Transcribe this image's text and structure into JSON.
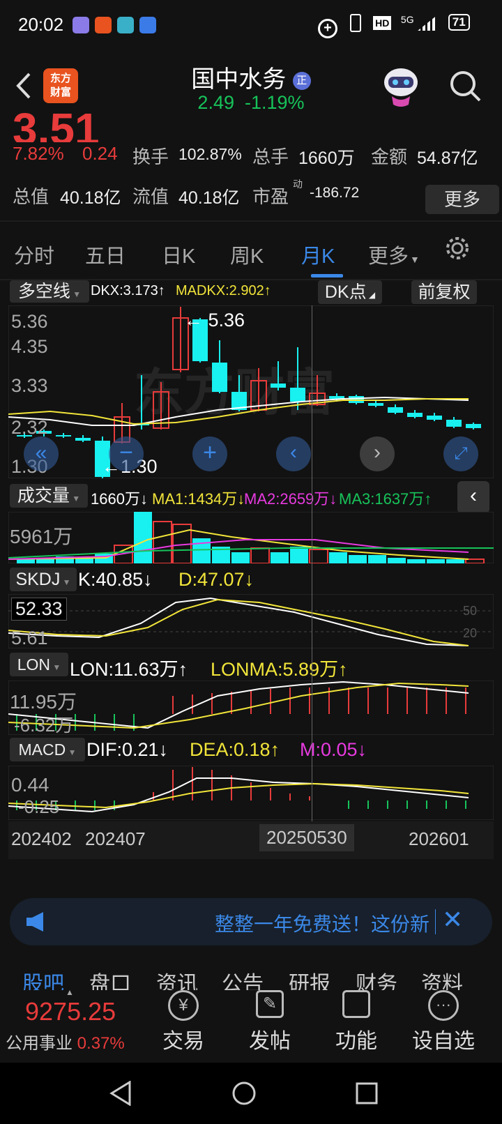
{
  "status": {
    "time": "20:02",
    "net": "5G",
    "battery": "71"
  },
  "header": {
    "logo_line1": "东方",
    "logo_line2": "财富",
    "title": "国中水务",
    "badge": "正",
    "price": "2.49",
    "change": "-1.19%"
  },
  "quote": {
    "price_big": "3.51",
    "pct": "7.82%",
    "chg": "0.24",
    "turnover_label": "换手",
    "turnover": "102.87%",
    "vol_label": "总手",
    "vol": "1660万",
    "amount_label": "金额",
    "amount": "54.87亿",
    "mcap_label": "总值",
    "mcap": "40.18亿",
    "float_label": "流值",
    "float": "40.18亿",
    "pe_label": "市盈",
    "pe_sup": "动",
    "pe": "-186.72",
    "more": "更多"
  },
  "tabs": [
    "分时",
    "五日",
    "日K",
    "周K",
    "月K",
    "更多"
  ],
  "main_chart": {
    "indicator": "多空线",
    "dkx": "DKX:3.173↑",
    "madkx": "MADKX:2.902↑",
    "dk_btn": "DK点",
    "fq_btn": "前复权",
    "ticks": [
      "5.36",
      "4.35",
      "3.33",
      "2.32",
      "1.30"
    ],
    "high_label": "← 5.36",
    "low_label": "←1.30"
  },
  "volume": {
    "label": "成交量",
    "vol": "1660万↓",
    "ma1": "MA1:1434万↓",
    "ma2": "MA2:2659万↓",
    "ma3": "MA3:1637万↑",
    "tick": "5961万"
  },
  "skdj": {
    "label": "SKDJ",
    "k": "K:40.85↓",
    "d": "D:47.07↓",
    "t1": "52.33",
    "t2": "5.61",
    "r1": "50",
    "r2": "20"
  },
  "lon": {
    "label": "LON",
    "lon": "LON:11.63万↑",
    "lonma": "LONMA:5.89万↑",
    "t1": "11.95万",
    "t2": "-6.32万"
  },
  "macd": {
    "label": "MACD",
    "dif": "DIF:0.21↓",
    "dea": "DEA:0.18↑",
    "m": "M:0.05↓",
    "t1": "0.44",
    "t2": "-0.25"
  },
  "dates": [
    "202402",
    "202407",
    "20250530",
    "202601"
  ],
  "ad": {
    "text": "整整一年免费送！这份新"
  },
  "bottom_tabs": [
    "股吧",
    "盘口",
    "资讯",
    "公告",
    "研报",
    "财务",
    "资料"
  ],
  "footer": {
    "index_val": "9275.25",
    "index_name": "公用事业",
    "index_pct": "0.37%",
    "trade": "交易",
    "post": "发帖",
    "func": "功能",
    "watch": "设自选"
  },
  "colors": {
    "up": "#e83b3b",
    "down": "#17c35a",
    "accent": "#3b88e8",
    "cyan": "#19f0f0",
    "yellow": "#f2e53a",
    "magenta": "#e83ae0"
  }
}
